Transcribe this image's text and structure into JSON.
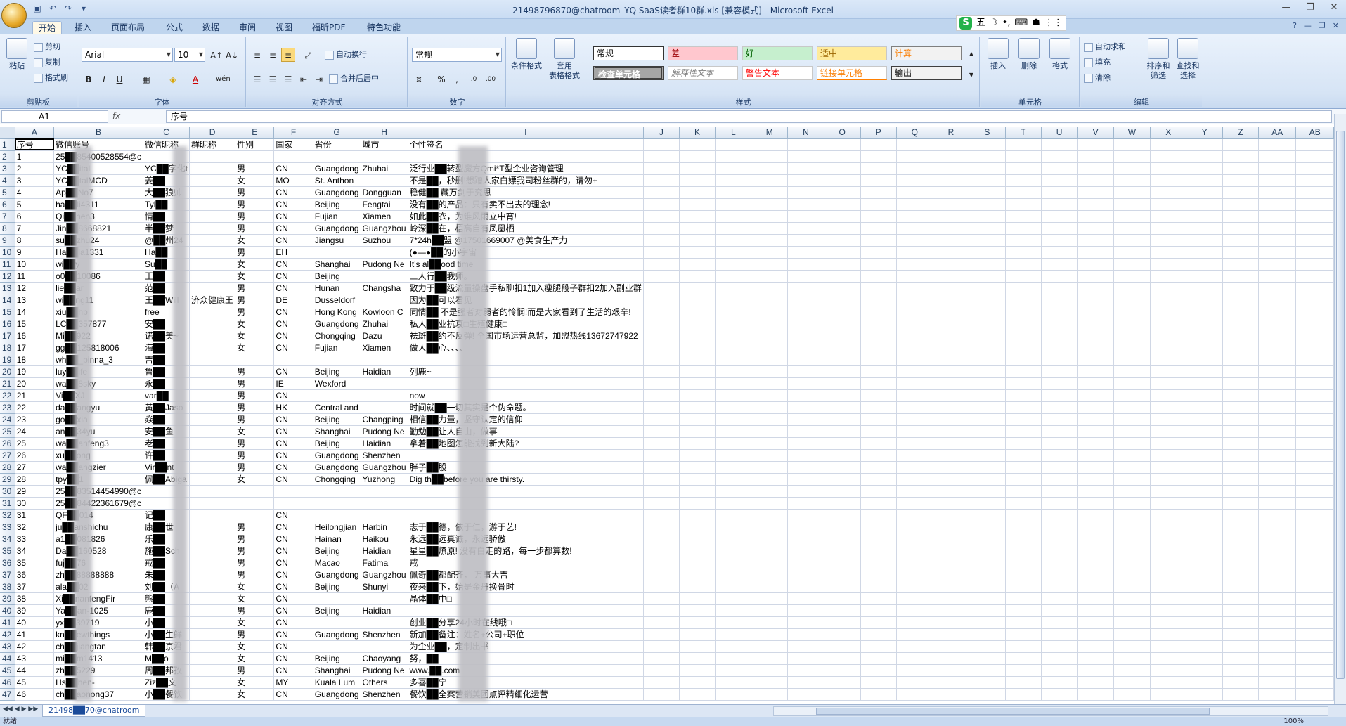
{
  "window": {
    "title": "21498796870@chatroom_YQ SaaS读者群10群.xls  [兼容模式] - Microsoft Excel"
  },
  "qat": {
    "icons": [
      "save-icon",
      "undo-icon",
      "redo-icon",
      "customize-icon"
    ]
  },
  "tabs": [
    "开始",
    "插入",
    "页面布局",
    "公式",
    "数据",
    "审阅",
    "视图",
    "福昕PDF",
    "特色功能"
  ],
  "ime": {
    "items": [
      "S",
      "五",
      "☽",
      "•,",
      "⌨",
      "☗",
      "⋮⋮"
    ]
  },
  "clipboard": {
    "paste": "粘贴",
    "cut": "剪切",
    "copy": "复制",
    "format_painter": "格式刷",
    "label": "剪贴板"
  },
  "font": {
    "name": "Arial",
    "size": "10",
    "label": "字体",
    "bold": "B",
    "italic": "I",
    "underline": "U",
    "grow": "A↑",
    "shrink": "A↓",
    "wen": "wén"
  },
  "alignment": {
    "wrap": "自动换行",
    "merge": "合并后居中",
    "label": "对齐方式"
  },
  "number": {
    "format": "常规",
    "percent": "%",
    "comma": ",",
    "label": "数字"
  },
  "styles": {
    "cond": "条件格式",
    "table": "套用\n表格格式",
    "label": "样式",
    "cells": [
      [
        "常规",
        "差",
        "好",
        "适中",
        "计算"
      ],
      [
        "检查单元格",
        "解释性文本",
        "警告文本",
        "链接单元格",
        "输出"
      ]
    ]
  },
  "cells": {
    "insert": "插入",
    "delete": "删除",
    "format": "格式",
    "label": "单元格"
  },
  "editing": {
    "autosum": "自动求和",
    "fill": "填充",
    "clear": "清除",
    "sort": "排序和\n筛选",
    "find": "查找和\n选择",
    "label": "编辑"
  },
  "namebox": "A1",
  "formula": "序号",
  "fx": "fx",
  "columns": [
    "A",
    "B",
    "C",
    "D",
    "E",
    "F",
    "G",
    "H",
    "I",
    "J",
    "K",
    "L",
    "M",
    "N",
    "O",
    "P",
    "Q",
    "R",
    "S",
    "T",
    "U",
    "V",
    "W",
    "X",
    "Y",
    "Z",
    "AA",
    "AB"
  ],
  "rows": [
    [
      "序号",
      "微信账号",
      "微信昵称",
      "群昵称",
      "性别",
      "国家",
      "省份",
      "城市",
      "个性签名"
    ],
    [
      "1",
      "25██85400528554@c",
      "",
      "",
      "",
      "",
      "",
      "",
      ""
    ],
    [
      "2",
      "YC██ital",
      "YC██字化t",
      "",
      "男",
      "CN",
      "Guangdong",
      "Zhuhai",
      "泛行业██转型魔方Qmi*T型企业咨询管理"
    ],
    [
      "3",
      "YC██talMCD",
      "姜██",
      "",
      "女",
      "MO",
      "St. Anthon",
      "",
      "不是██，秒删!想蹭人家白嫖我司粉丝群的，请勿+"
    ],
    [
      "4",
      "Ap██No7",
      "大██狼帅",
      "",
      "男",
      "CN",
      "Guangdong",
      "Dongguan",
      "稳健██  藏万剑于究思"
    ],
    [
      "5",
      "ha██li4311",
      "Tyl██",
      "",
      "男",
      "CN",
      "Beijing",
      "Fengtai",
      "没有██的产品：只有卖不出去的理念!"
    ],
    [
      "6",
      "Qi██hen3",
      "情██",
      "",
      "男",
      "CN",
      "Fujian",
      "Xiamen",
      "如此██衣，为谁风雨立中宵!"
    ],
    [
      "7",
      "Jin██8668821",
      "半██梦",
      "",
      "男",
      "CN",
      "Guangdong",
      "Guangzhou",
      "岭深██在，梧高自有凤凰栖"
    ],
    [
      "8",
      "su██zhu24",
      "@██州24",
      "",
      "女",
      "CN",
      "Jiangsu",
      "Suzhou",
      "7*24h██盟 @17501669007 @美食生产力"
    ],
    [
      "9",
      "Ha██la1331",
      "Ha██",
      "",
      "男",
      "EH",
      "",
      "",
      "(●—●██的小宇宙"
    ],
    [
      "10",
      "wi██y",
      "Su██",
      "",
      "女",
      "CN",
      "Shanghai",
      "Pudong Ne",
      "It's al██ood time"
    ],
    [
      "11",
      "o0██10086",
      "王██",
      "",
      "女",
      "CN",
      "Beijing",
      "",
      "三人行██我师。"
    ],
    [
      "12",
      "lie██ar",
      "范██",
      "",
      "男",
      "CN",
      "Hunan",
      "Changsha",
      "致力于██级流量操盘手私聊扣1加入瘦腿段子群扣2加入副业群"
    ],
    [
      "13",
      "wi██ng11",
      "王██Will",
      "济众健康王",
      "男",
      "DE",
      "Dusseldorf",
      "",
      "因为██可以看见"
    ],
    [
      "14",
      "xiu██hp",
      "free",
      "",
      "男",
      "CN",
      "Hong Kong",
      "Kowloon C",
      "同情██ 不是强者对弱者的怜悯!而是大家看到了生活的艰辛!"
    ],
    [
      "15",
      "LC██357877",
      "安██",
      "",
      "女",
      "CN",
      "Guangdong",
      "Zhuhai",
      "私人██业抗衰□生殖健康□"
    ],
    [
      "16",
      "Mi██922",
      "诺██美~",
      "",
      "女",
      "CN",
      "Chongqing",
      "Dazu",
      "祛斑██约不反弹! 全国市场运营总监，加盟热线13672747922"
    ],
    [
      "17",
      "gg██125818006",
      "海██",
      "",
      "女",
      "CN",
      "Fujian",
      "Xiamen",
      "做人██心、、、、"
    ],
    [
      "18",
      "wh██_pinna_3",
      "吉██",
      "",
      "",
      "",
      "",
      "",
      ""
    ],
    [
      "19",
      "luy██ife",
      "鲁██",
      "",
      "男",
      "CN",
      "Beijing",
      "Haidian",
      "列鹿~"
    ],
    [
      "20",
      "wa██8sky",
      "永██",
      "",
      "男",
      "IE",
      "Wexford",
      "",
      ""
    ],
    [
      "21",
      "Vi██XJ",
      "var██",
      "",
      "男",
      "CN",
      "",
      "",
      "now"
    ],
    [
      "22",
      "da██angyu",
      "黄██Jaso",
      "",
      "男",
      "HK",
      "Central and",
      "",
      "时间就██一切其实是个伪命题。"
    ],
    [
      "23",
      "go██xia",
      "焱██",
      "",
      "男",
      "CN",
      "Beijing",
      "Changping",
      "相信██力量，坚守认定的信仰"
    ],
    [
      "24",
      "an██34yu",
      "安██鱼",
      "",
      "女",
      "CN",
      "Shanghai",
      "Pudong Ne",
      "勤勉██让人自由，做事"
    ],
    [
      "25",
      "wa██anfeng3",
      "老██",
      "",
      "男",
      "CN",
      "Beijing",
      "Haidian",
      "拿着██地图怎能找到新大陆?"
    ],
    [
      "26",
      "xu██ong",
      "许██",
      "",
      "男",
      "CN",
      "Guangdong",
      "Shenzhen",
      ""
    ],
    [
      "27",
      "wa██angzier",
      "Vir██nt",
      "",
      "男",
      "CN",
      "Guangdong",
      "Guangzhou",
      "胖子██股"
    ],
    [
      "28",
      "tpy██1",
      "佩██Abiga",
      "",
      "女",
      "CN",
      "Chongqing",
      "Yuzhong",
      "Dig th██before you are thirsty."
    ],
    [
      "29",
      "25██83514454990@c",
      "",
      "",
      "",
      "",
      "",
      "",
      ""
    ],
    [
      "30",
      "25██84422361679@c",
      "",
      "",
      "",
      "",
      "",
      "",
      ""
    ],
    [
      "31",
      "QF██014",
      "记██",
      "",
      "",
      "CN",
      "",
      "",
      ""
    ],
    [
      "32",
      "ju██anshichu",
      "康██世",
      "",
      "男",
      "CN",
      "Heilongjian",
      "Harbin",
      "志于██德，依于仁，游于艺!"
    ],
    [
      "33",
      "a1██081826",
      "乐██",
      "",
      "男",
      "CN",
      "Hainan",
      "Haikou",
      "永远██远真诚，永远骄傲"
    ],
    [
      "34",
      "Da██160528",
      "施██Sch",
      "",
      "男",
      "CN",
      "Beijing",
      "Haidian",
      "星星██燎原! 没有白走的路，每一步都算数!"
    ],
    [
      "35",
      "fuj██76",
      "戒██",
      "",
      "男",
      "CN",
      "Macao",
      "Fatima",
      "戒"
    ],
    [
      "36",
      "zh██88888888",
      "朱██",
      "",
      "男",
      "CN",
      "Guangdong",
      "Guangzhou",
      "佩奇██都配齐，   万事大吉"
    ],
    [
      "37",
      "ala██02",
      "刘██（A",
      "",
      "女",
      "CN",
      "Beijing",
      "Shunyi",
      "夜来██下，始是金丹换骨时"
    ],
    [
      "38",
      "Xi██nanfengFir",
      "熊██",
      "",
      "女",
      "CN",
      "",
      "",
      "晶体██中□"
    ],
    [
      "39",
      "Ya██an-1025",
      "鹿██",
      "",
      "男",
      "CN",
      "Beijing",
      "Haidian",
      ""
    ],
    [
      "40",
      "yx██39719",
      "小██",
      "",
      "女",
      "CN",
      "",
      "",
      "创业██分享24小时在线哦□"
    ],
    [
      "41",
      "kn██ewthings",
      "小██生鲜",
      "",
      "男",
      "CN",
      "Guangdong",
      "Shenzhen",
      "新加██备注：姓名+公司+职位"
    ],
    [
      "42",
      "ch██jiangtan",
      "韩██京君",
      "",
      "女",
      "CN",
      "",
      "",
      "为企业██，定制出书"
    ],
    [
      "43",
      "mi██m1413",
      "M██o",
      "",
      "女",
      "CN",
      "Beijing",
      "Chaoyang",
      "努，██"
    ],
    [
      "44",
      "zh██5229",
      "周██邦孜",
      "",
      "男",
      "CN",
      "Shanghai",
      "Pudong Ne",
      "www.██.com"
    ],
    [
      "45",
      "Hs██hen-",
      "Ziz██文",
      "",
      "女",
      "MY",
      "Kuala Lum",
      "Others",
      "多喜██宁"
    ],
    [
      "46",
      "ch██aonong37",
      "小██餐饮",
      "",
      "女",
      "CN",
      "Guangdong",
      "Shenzhen",
      "餐饮██全案营销美团点评精细化运营"
    ]
  ],
  "sheet_tab": "21498██70@chatroom",
  "status": "就绪",
  "zoom": "100%"
}
